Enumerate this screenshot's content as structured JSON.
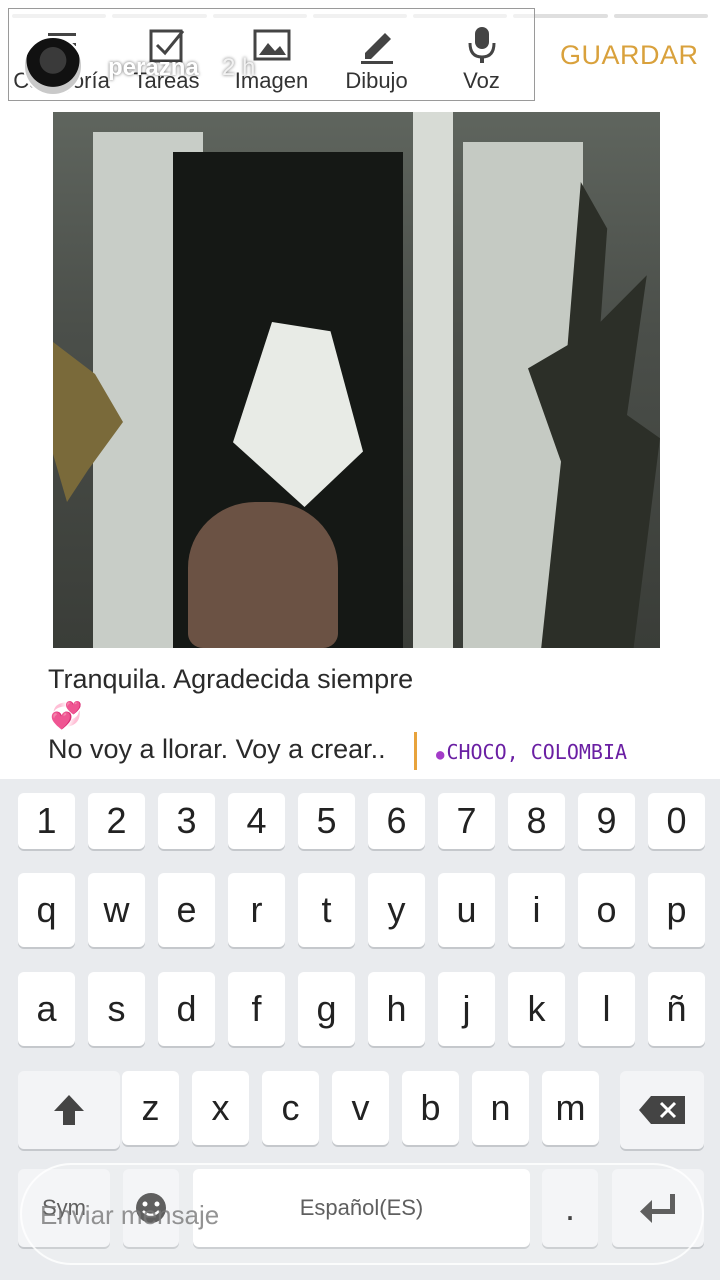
{
  "story": {
    "progress_segments": 7,
    "username": "perazna",
    "time": "2 h"
  },
  "toolbar": {
    "items": [
      {
        "label": "Categoría",
        "icon": "list-icon"
      },
      {
        "label": "Tareas",
        "icon": "checkbox-icon"
      },
      {
        "label": "Imagen",
        "icon": "image-icon"
      },
      {
        "label": "Dibujo",
        "icon": "pencil-icon"
      },
      {
        "label": "Voz",
        "icon": "microphone-icon"
      }
    ],
    "save_label": "GUARDAR",
    "save_color": "#d9a13c"
  },
  "caption": {
    "line1": "Tranquila. Agradecida siempre",
    "emoji": "💞",
    "line3": "No voy a llorar. Voy a crear..",
    "location": "CHOCO, COLOMBIA"
  },
  "keyboard": {
    "row_numbers": [
      "1",
      "2",
      "3",
      "4",
      "5",
      "6",
      "7",
      "8",
      "9",
      "0"
    ],
    "row_top": [
      "q",
      "w",
      "e",
      "r",
      "t",
      "y",
      "u",
      "i",
      "o",
      "p"
    ],
    "row_mid": [
      "a",
      "s",
      "d",
      "f",
      "g",
      "h",
      "j",
      "k",
      "l",
      "ñ"
    ],
    "row_bottom": [
      "z",
      "x",
      "c",
      "v",
      "b",
      "n",
      "m"
    ],
    "sym_label": "Sym",
    "space_label": "Español(ES)",
    "period_label": "."
  },
  "message_bar": {
    "placeholder": "Enviar mensaje"
  }
}
